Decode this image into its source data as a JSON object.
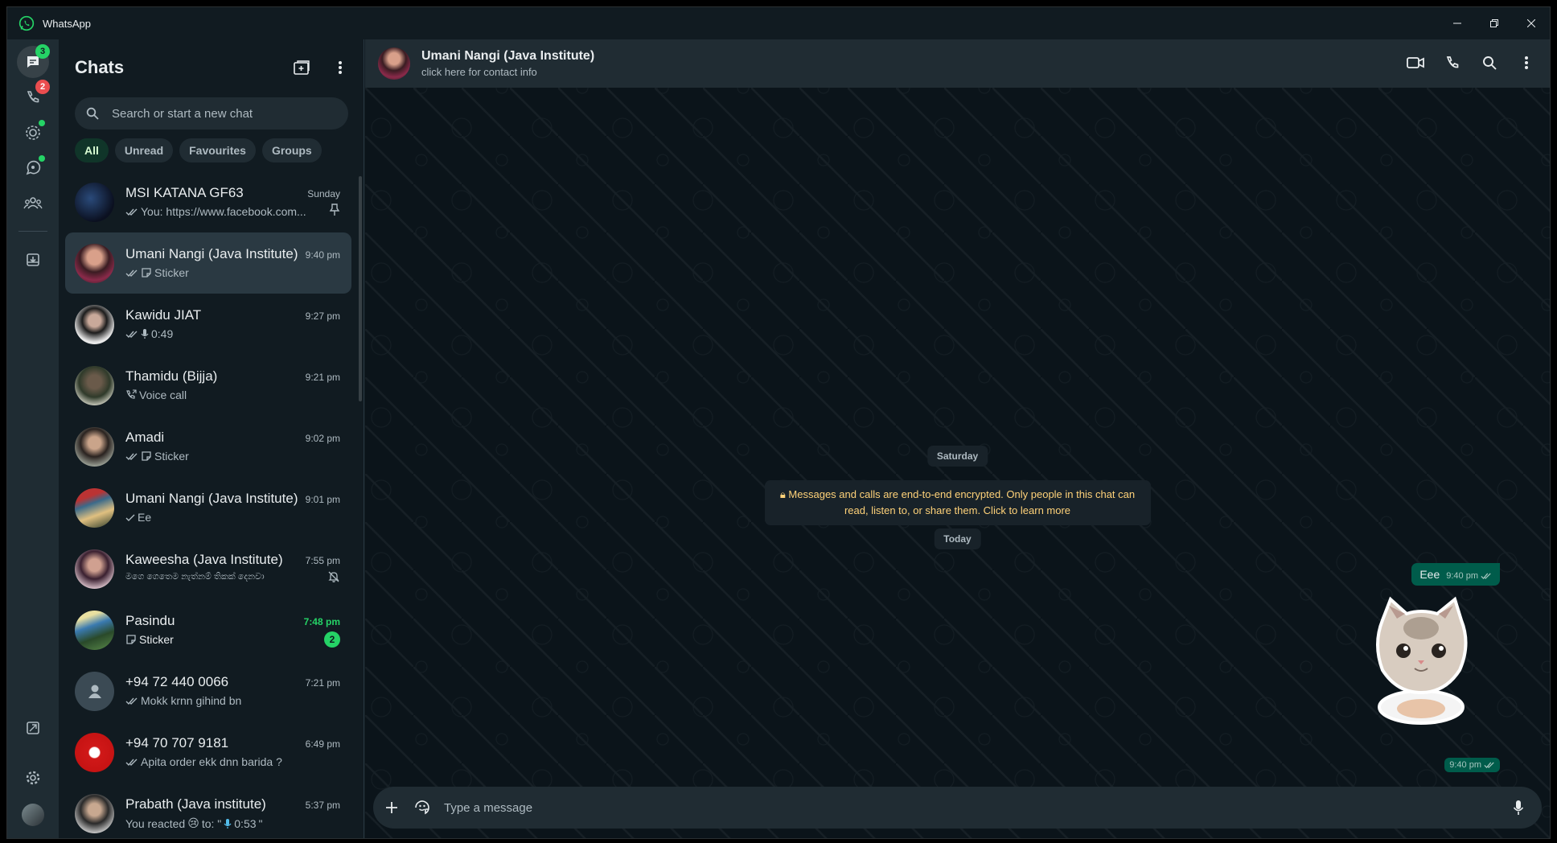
{
  "window": {
    "title": "WhatsApp"
  },
  "colors": {
    "accent": "#25d366",
    "unread_badge": "#25d366",
    "missed_badge": "#ea4d4f",
    "outgoing_bubble": "#005c4b",
    "encryption_text": "#ffd279"
  },
  "rail": {
    "chats_badge": "3",
    "calls_badge": "2",
    "icons": [
      "chats-icon",
      "calls-icon",
      "status-icon",
      "channels-icon",
      "communities-icon",
      "archived-icon",
      "starred-icon",
      "settings-icon",
      "profile-avatar"
    ]
  },
  "chatlist": {
    "title": "Chats",
    "search_placeholder": "Search or start a new chat",
    "filters": [
      "All",
      "Unread",
      "Favourites",
      "Groups"
    ],
    "active_filter": "All",
    "rows": [
      {
        "name": "MSI KATANA GF63",
        "time": "Sunday",
        "preview": "You: https://www.facebook.com...",
        "tick": "double",
        "pinned": true
      },
      {
        "name": "Umani Nangi (Java Institute)",
        "time": "9:40 pm",
        "preview": "Sticker",
        "tick": "double",
        "type": "sticker",
        "selected": true
      },
      {
        "name": "Kawidu JIAT",
        "time": "9:27 pm",
        "preview": "0:49",
        "tick": "double",
        "type": "voice"
      },
      {
        "name": "Thamidu (Bijja)",
        "time": "9:21 pm",
        "preview": "Voice call",
        "type": "call"
      },
      {
        "name": "Amadi",
        "time": "9:02 pm",
        "preview": "Sticker",
        "tick": "double",
        "type": "sticker"
      },
      {
        "name": "Umani Nangi (Java Institute)",
        "time": "9:01 pm",
        "preview": "Ee",
        "tick": "single"
      },
      {
        "name": "Kaweesha (Java Institute)",
        "time": "7:55 pm",
        "preview": "මගෙ ගෙතෙම නැත්නම් තිකක් දෙනවා",
        "muted": true
      },
      {
        "name": "Pasindu",
        "time": "7:48 pm",
        "preview": "Sticker",
        "type": "sticker",
        "unread": "2"
      },
      {
        "name": "+94 72 440 0066",
        "time": "7:21 pm",
        "preview": "Mokk krnn gihind bn",
        "tick": "double"
      },
      {
        "name": "+94 70 707 9181",
        "time": "6:49 pm",
        "preview": "Apita order ekk dnn barida ?",
        "tick": "double"
      },
      {
        "name": "Prabath (Java institute)",
        "time": "5:37 pm",
        "preview_prefix": "You reacted",
        "preview_emoji": "😢",
        "preview_mid": "to: \"",
        "preview_voice": "0:53",
        "preview_suffix": "\""
      }
    ]
  },
  "conversation": {
    "contact_name": "Umani Nangi (Java Institute)",
    "contact_sub": "click here for contact info",
    "date_1": "Saturday",
    "encryption_notice": "Messages and calls are end-to-end encrypted. Only people in this chat can read, listen to, or share them. Click to learn more",
    "date_2": "Today",
    "outgoing_text": "Eee",
    "outgoing_time": "9:40 pm",
    "sticker_time": "9:40 pm",
    "composer_placeholder": "Type a message"
  }
}
